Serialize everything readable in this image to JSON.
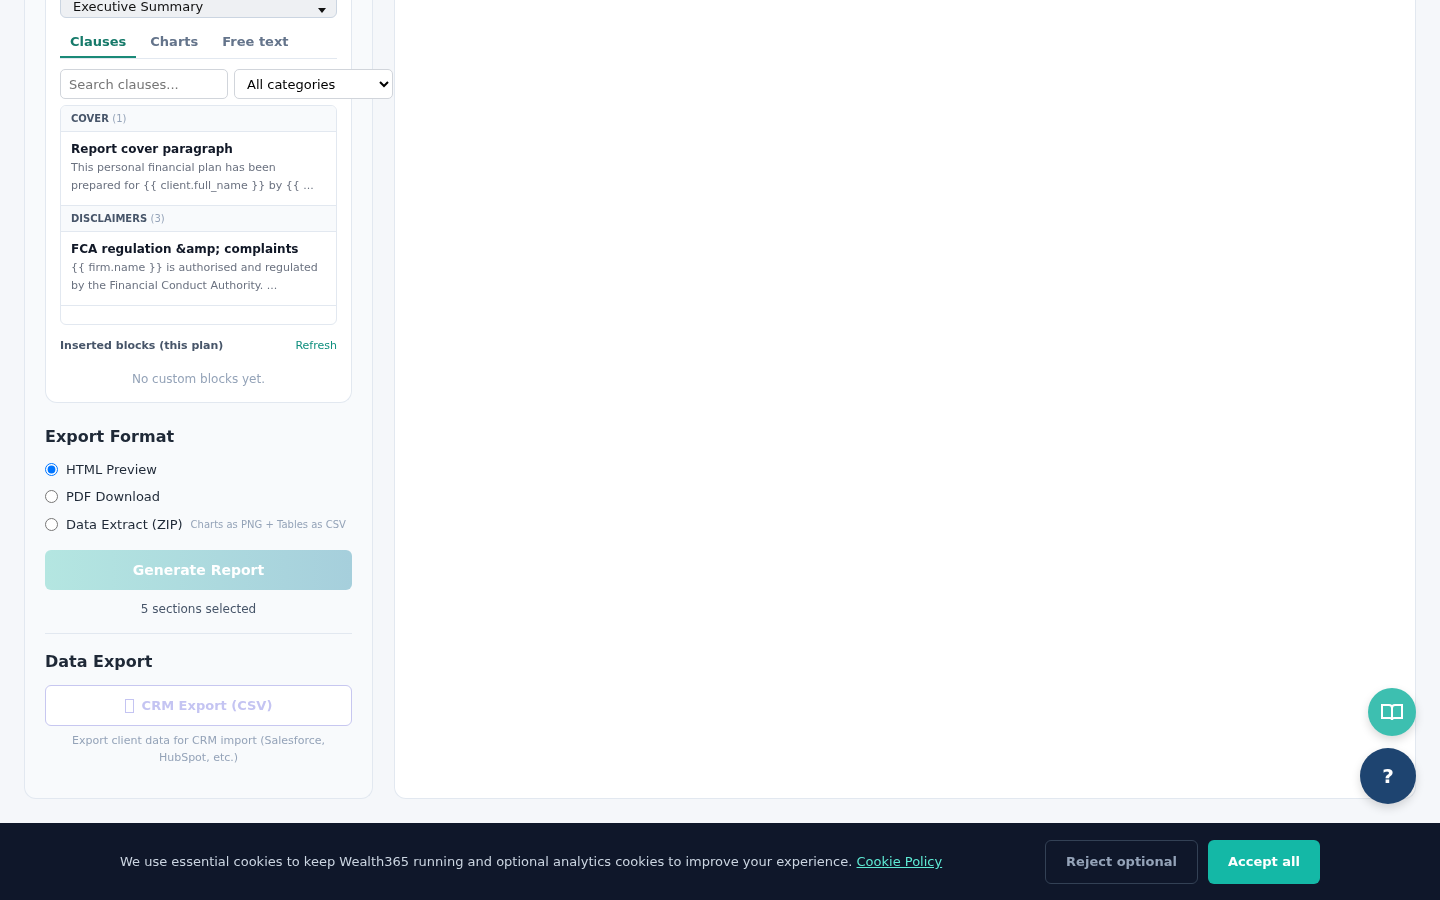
{
  "section_select": {
    "value": "Executive Summary"
  },
  "library": {
    "tabs": [
      {
        "label": "Clauses",
        "selected": true
      },
      {
        "label": "Charts",
        "selected": false
      },
      {
        "label": "Free text",
        "selected": false
      }
    ],
    "search": {
      "placeholder": "Search clauses..."
    },
    "category": {
      "value": "All categories"
    },
    "groups": [
      {
        "name": "COVER",
        "count": "(1)",
        "clauses": [
          {
            "title": "Report cover paragraph",
            "preview": "This personal financial plan has been prepared for {{ client.full_name }} by {{ ..."
          }
        ]
      },
      {
        "name": "DISCLAIMERS",
        "count": "(3)",
        "clauses": [
          {
            "title": "FCA regulation &amp; complaints",
            "preview": "{{ firm.name }} is authorised and regulated by the Financial Conduct Authority. ..."
          }
        ]
      }
    ],
    "inserted_label": "Inserted blocks (this plan)",
    "refresh": "Refresh",
    "empty": "No custom blocks yet."
  },
  "export_format": {
    "title": "Export Format",
    "options": [
      {
        "label": "HTML Preview",
        "selected": true
      },
      {
        "label": "PDF Download",
        "selected": false
      },
      {
        "label": "Data Extract (ZIP)",
        "hint": "Charts as PNG + Tables as CSV",
        "selected": false
      }
    ],
    "generate": {
      "label": "Generate Report",
      "disabled": true
    },
    "summary": "5 sections selected"
  },
  "data_export": {
    "title": "Data Export",
    "button": "CRM Export (CSV)",
    "note": "Export client data for CRM import (Salesforce, HubSpot, etc.)"
  },
  "help_button": "?",
  "cookie_banner": {
    "text": "We use essential cookies to keep Wealth365 running and optional analytics cookies to improve your experience.",
    "link": "Cookie Policy",
    "buttons": [
      {
        "label": "Reject optional",
        "kind": "secondary"
      },
      {
        "label": "Accept all",
        "kind": "primary"
      }
    ]
  }
}
